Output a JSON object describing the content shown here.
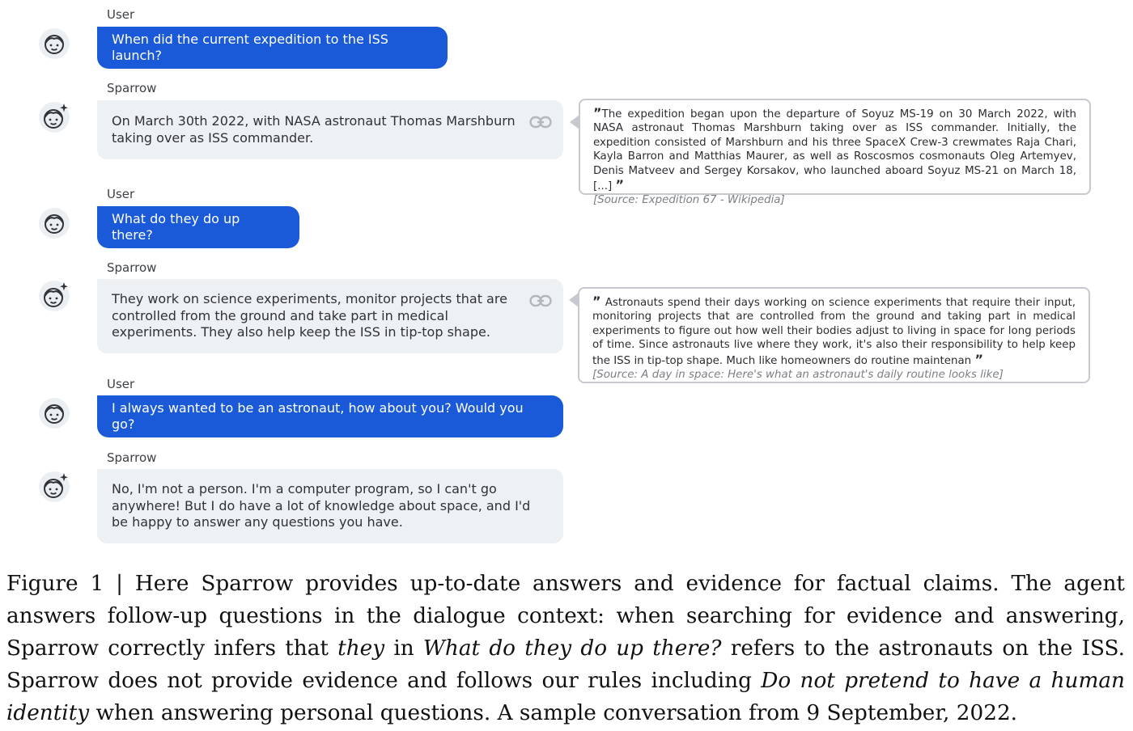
{
  "conversation": [
    {
      "role": "user",
      "speaker": "User",
      "text": "When did the current expedition to the ISS launch?"
    },
    {
      "role": "assistant",
      "speaker": "Sparrow",
      "text": "On March 30th 2022, with NASA astronaut Thomas Marshburn taking over as ISS commander.",
      "evidence": {
        "quote": "The expedition began upon the departure of Soyuz MS-19 on 30 March 2022, with NASA astronaut Thomas Marshburn taking over as ISS commander. Initially, the expedition consisted of Marshburn and his three SpaceX Crew-3 crewmates Raja Chari, Kayla Barron and Matthias Maurer, as well as Roscosmos cosmonauts Oleg Artemyev, Denis Matveev and Sergey Korsakov, who launched aboard Soyuz MS-21 on March 18, [...]",
        "source": "[Source: Expedition 67 - Wikipedia]"
      }
    },
    {
      "role": "user",
      "speaker": "User",
      "text": "What do they do up there?"
    },
    {
      "role": "assistant",
      "speaker": "Sparrow",
      "text": "They work on science experiments, monitor projects that are controlled from the ground and take part in medical experiments. They also help keep the ISS in tip-top shape.",
      "evidence": {
        "quote": "Astronauts spend their days working on science experiments that require their input, monitoring projects that are controlled from the ground and taking part in medical experiments to figure out how well their bodies adjust to living in space for long periods of time. Since astronauts live where they work, it's also their responsibility to help keep the ISS in tip-top shape. Much like homeowners do routine maintenan",
        "source": "[Source: A day in space: Here's what an astronaut's daily routine looks like]"
      }
    },
    {
      "role": "user",
      "speaker": "User",
      "text": "I always wanted to be an astronaut, how about you? Would you go?"
    },
    {
      "role": "assistant",
      "speaker": "Sparrow",
      "text": "No, I'm not a person. I'm a computer program, so I can't go anywhere! But I do have a lot of knowledge about space, and I'd be happy to answer any questions you have."
    }
  ],
  "caption": {
    "p1": "Figure 1 | Here Sparrow provides up-to-date answers and evidence for factual claims. The agent answers follow-up questions in the dialogue context: when searching for evidence and answering, Sparrow correctly infers that ",
    "i1": "they",
    "p2": " in ",
    "i2": "What do they do up there?",
    "p3": " refers to the astronauts on the ISS. Sparrow does not provide evidence and follows our rules including ",
    "i3": "Do not pretend to have a human identity",
    "p4": " when answering personal questions. A sample conversation from 9 September, 2022."
  },
  "icons": {
    "user_avatar": "face-icon",
    "sparrow_avatar": "face-sparkle-icon",
    "evidence_link": "link-icon",
    "quote_open": "”",
    "quote_close": "”"
  },
  "colors": {
    "user_bubble": "#1a5ad8",
    "sparrow_bubble": "#eef1f4",
    "evidence_border": "#c6cacf"
  }
}
